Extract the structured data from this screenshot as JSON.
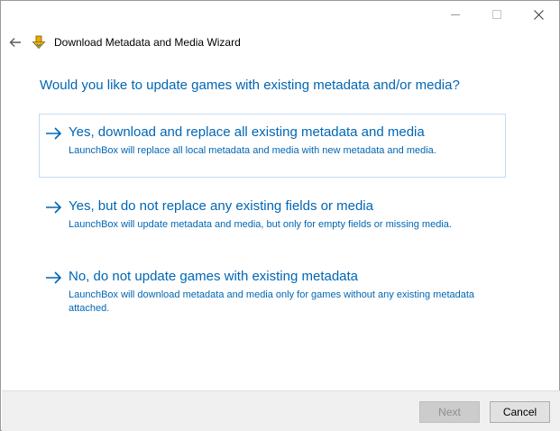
{
  "window": {
    "controls": [
      "minimize",
      "maximize",
      "close"
    ]
  },
  "header": {
    "title": "Download Metadata and Media Wizard",
    "back_icon": "back-arrow-icon",
    "app_icon": "download-arrow-icon"
  },
  "heading": "Would you like to update games with existing metadata and/or media?",
  "options": [
    {
      "title": "Yes, download and replace all existing metadata and media",
      "description": "LaunchBox will replace all local metadata and media with new metadata and media.",
      "selected": true
    },
    {
      "title": "Yes, but do not replace any existing fields or media",
      "description": "LaunchBox will update metadata and media, but only for empty fields or missing media.",
      "selected": false
    },
    {
      "title": "No, do not update games with existing metadata",
      "description": "LaunchBox will download metadata and media only for games without any existing metadata attached.",
      "selected": false
    }
  ],
  "footer": {
    "next_label": "Next",
    "cancel_label": "Cancel"
  },
  "colors": {
    "accent": "#0066b4",
    "selected_border": "#c2dcf2",
    "footer_bg": "#f0f0f0"
  }
}
